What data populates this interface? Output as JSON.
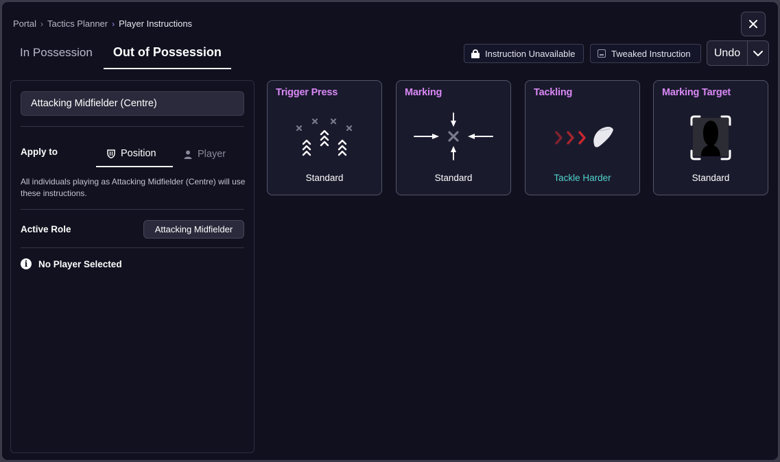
{
  "breadcrumb": {
    "items": [
      "Portal",
      "Tactics Planner",
      "Player Instructions"
    ]
  },
  "tabs": [
    {
      "label": "In Possession"
    },
    {
      "label": "Out of Possession"
    }
  ],
  "legend": {
    "unavailable": "Instruction Unavailable",
    "tweaked": "Tweaked Instruction"
  },
  "undo": {
    "label": "Undo"
  },
  "panel": {
    "position_value": "Attacking Midfielder (Centre)",
    "apply_label": "Apply to",
    "apply_tabs": {
      "position": "Position",
      "player": "Player"
    },
    "description": "All individuals playing as Attacking Midfielder (Centre) will use these instructions.",
    "role_label": "Active Role",
    "role_value": "Attacking Midfielder",
    "no_player": "No Player Selected"
  },
  "cards": [
    {
      "title": "Trigger Press",
      "value": "Standard",
      "icon": "trigger-press-icon"
    },
    {
      "title": "Marking",
      "value": "Standard",
      "icon": "marking-icon"
    },
    {
      "title": "Tackling",
      "value": "Tackle Harder",
      "icon": "tackling-icon"
    },
    {
      "title": "Marking Target",
      "value": "Standard",
      "icon": "marking-target-icon"
    }
  ],
  "colors": {
    "title_accent": "#d889f4",
    "tweaked_accent": "#51d4cc",
    "background": "#10101f",
    "tackle_red": "#c8282e"
  }
}
